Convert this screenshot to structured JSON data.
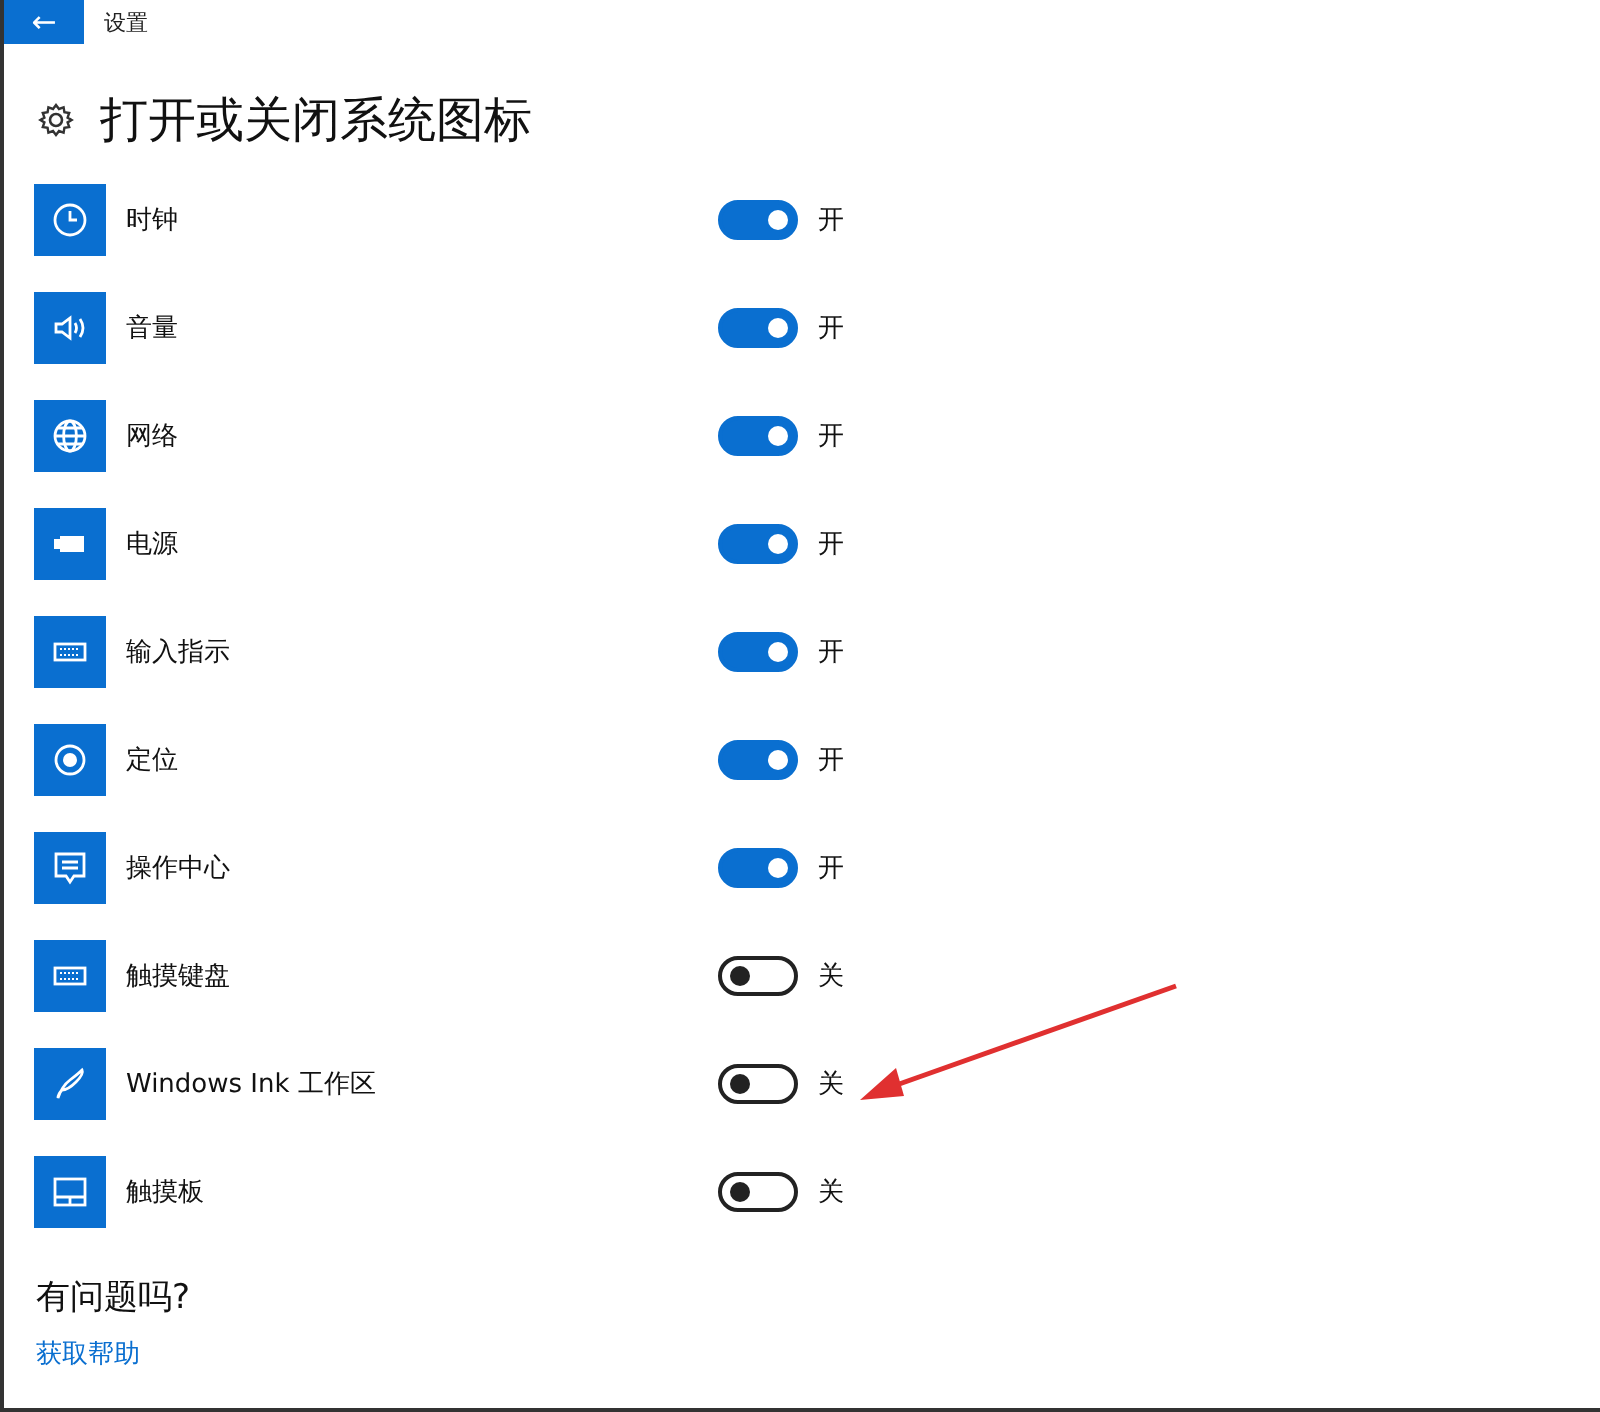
{
  "window": {
    "title": "设置",
    "back_button": {
      "label": "←"
    }
  },
  "heading": "打开或关闭系统图标",
  "items": [
    {
      "label": "时钟",
      "on": true,
      "state_text": "开"
    },
    {
      "label": "音量",
      "on": true,
      "state_text": "开"
    },
    {
      "label": "网络",
      "on": true,
      "state_text": "开"
    },
    {
      "label": "电源",
      "on": true,
      "state_text": "开"
    },
    {
      "label": "输入指示",
      "on": true,
      "state_text": "开"
    },
    {
      "label": "定位",
      "on": true,
      "state_text": "开"
    },
    {
      "label": "操作中心",
      "on": true,
      "state_text": "开"
    },
    {
      "label": "触摸键盘",
      "on": false,
      "state_text": "关"
    },
    {
      "label": "Windows Ink 工作区",
      "on": false,
      "state_text": "关"
    },
    {
      "label": "触摸板",
      "on": false,
      "state_text": "关"
    }
  ],
  "help": {
    "title": "有问题吗?",
    "link": "获取帮助"
  },
  "annotation": {
    "kind": "arrow"
  }
}
